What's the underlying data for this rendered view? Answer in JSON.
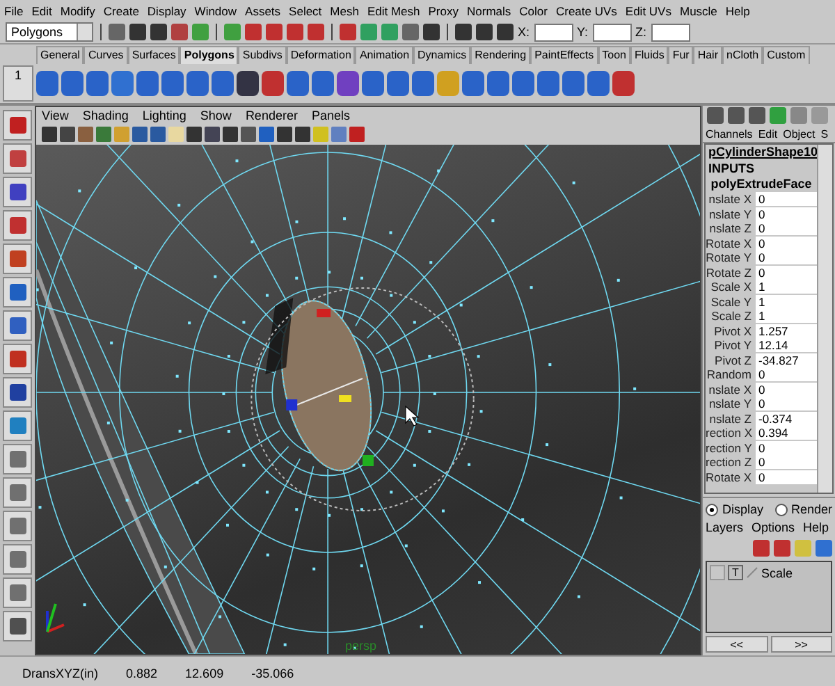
{
  "menu_bar": [
    "File",
    "Edit",
    "Modify",
    "Create",
    "Display",
    "Window",
    "Assets",
    "Select",
    "Mesh",
    "Edit Mesh",
    "Proxy",
    "Normals",
    "Color",
    "Create UVs",
    "Edit UVs",
    "Muscle",
    "Help"
  ],
  "status_line": {
    "mode": "Polygons",
    "coord_labels": [
      "X:",
      "Y:",
      "Z:"
    ]
  },
  "shelf": {
    "tabs": [
      {
        "label": "General",
        "selected": false
      },
      {
        "label": "Curves",
        "selected": false
      },
      {
        "label": "Surfaces",
        "selected": false
      },
      {
        "label": "Polygons",
        "selected": true
      },
      {
        "label": "Subdivs",
        "selected": false
      },
      {
        "label": "Deformation",
        "selected": false
      },
      {
        "label": "Animation",
        "selected": false
      },
      {
        "label": "Dynamics",
        "selected": false
      },
      {
        "label": "Rendering",
        "selected": false
      },
      {
        "label": "PaintEffects",
        "selected": false
      },
      {
        "label": "Toon",
        "selected": false
      },
      {
        "label": "Fluids",
        "selected": false
      },
      {
        "label": "Fur",
        "selected": false
      },
      {
        "label": "Hair",
        "selected": false
      },
      {
        "label": "nCloth",
        "selected": false
      },
      {
        "label": "Custom",
        "selected": false
      }
    ],
    "shelf_number": "1"
  },
  "panel_menu": [
    "View",
    "Shading",
    "Lighting",
    "Show",
    "Renderer",
    "Panels"
  ],
  "viewport": {
    "camera_label": "persp"
  },
  "channel_box": {
    "menu": [
      "Channels",
      "Edit",
      "Object",
      "S"
    ],
    "object": "pCylinderShape10",
    "section": "INPUTS",
    "node": "polyExtrudeFace",
    "attributes": [
      {
        "name": "nslate X",
        "value": "0"
      },
      {
        "name": "nslate Y",
        "value": "0"
      },
      {
        "name": "nslate Z",
        "value": "0"
      },
      {
        "name": "Rotate X",
        "value": "0"
      },
      {
        "name": "Rotate Y",
        "value": "0"
      },
      {
        "name": "Rotate Z",
        "value": "0"
      },
      {
        "name": "Scale X",
        "value": "1"
      },
      {
        "name": "Scale Y",
        "value": "1"
      },
      {
        "name": "Scale Z",
        "value": "1"
      },
      {
        "name": "Pivot X",
        "value": "1.257"
      },
      {
        "name": "Pivot Y",
        "value": "12.14"
      },
      {
        "name": "Pivot Z",
        "value": "-34.827"
      },
      {
        "name": "Random",
        "value": "0"
      },
      {
        "name": "nslate X",
        "value": "0"
      },
      {
        "name": "nslate Y",
        "value": "0"
      },
      {
        "name": "nslate Z",
        "value": "-0.374"
      },
      {
        "name": "rection X",
        "value": "0.394"
      },
      {
        "name": "rection Y",
        "value": "0"
      },
      {
        "name": "rection Z",
        "value": "0"
      },
      {
        "name": "Rotate X",
        "value": "0"
      }
    ]
  },
  "layer_editor": {
    "modes": [
      {
        "label": "Display",
        "selected": true
      },
      {
        "label": "Render",
        "selected": false
      }
    ],
    "menu": [
      "Layers",
      "Options",
      "Help"
    ],
    "layers": [
      {
        "visible": false,
        "type_flag": "T",
        "name": "Scale"
      }
    ],
    "page_buttons": [
      "<<",
      ">>"
    ]
  },
  "help_line": {
    "label": "DransXYZ(in)",
    "values": [
      "0.882",
      "12.609",
      "-35.066"
    ]
  }
}
